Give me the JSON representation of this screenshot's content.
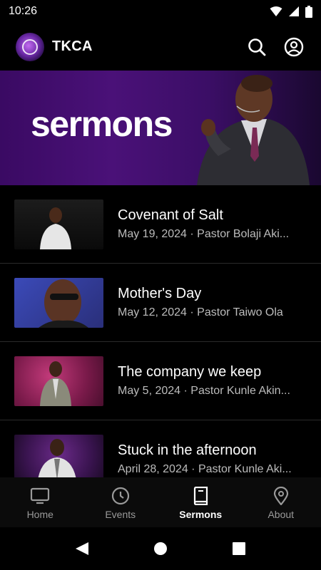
{
  "status": {
    "time": "10:26"
  },
  "app": {
    "title": "TKCA"
  },
  "banner": {
    "text": "sermons"
  },
  "sermons": [
    {
      "title": "Covenant of Salt",
      "subtitle": "May 19, 2024 · Pastor Bolaji Aki..."
    },
    {
      "title": "Mother's Day",
      "subtitle": "May 12, 2024 · Pastor Taiwo Ola"
    },
    {
      "title": "The company we keep",
      "subtitle": "May 5, 2024 · Pastor Kunle Akin..."
    },
    {
      "title": "Stuck in the afternoon",
      "subtitle": "April 28, 2024 · Pastor Kunle Aki..."
    }
  ],
  "nav": {
    "items": [
      {
        "label": "Home",
        "icon": "tv-icon"
      },
      {
        "label": "Events",
        "icon": "clock-icon"
      },
      {
        "label": "Sermons",
        "icon": "book-icon"
      },
      {
        "label": "About",
        "icon": "location-pin-icon"
      }
    ],
    "active": "Sermons"
  },
  "colors": {
    "background": "#000000",
    "banner": "#4a1178",
    "secondary_text": "#bcbcbc"
  }
}
